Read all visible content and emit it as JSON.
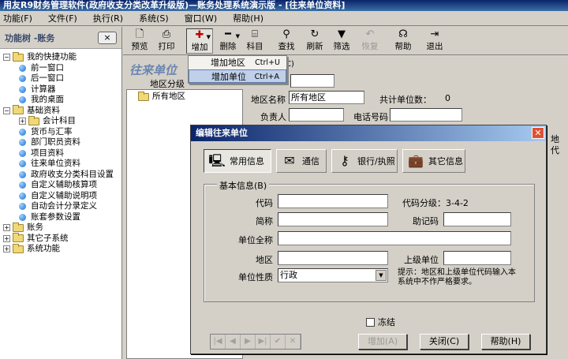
{
  "window": {
    "title": "用友R9财务管理软件(政府收支分类改革升级版)—账务处理系统演示版 - [往来单位资料]"
  },
  "menu": [
    "功能(F)",
    "文件(F)",
    "执行(R)",
    "系统(S)",
    "窗口(W)",
    "帮助(H)"
  ],
  "left_panel": {
    "title": "功能树 -账务",
    "close": "×",
    "tree": [
      {
        "label": "我的快捷功能",
        "kind": "folder",
        "expand": "−",
        "level": 0
      },
      {
        "label": "前一窗口",
        "kind": "item",
        "level": 1
      },
      {
        "label": "后一窗口",
        "kind": "item",
        "level": 1
      },
      {
        "label": "计算器",
        "kind": "item",
        "level": 1
      },
      {
        "label": "我的桌面",
        "kind": "item",
        "level": 1
      },
      {
        "label": "基础资料",
        "kind": "folder",
        "expand": "−",
        "level": 0
      },
      {
        "label": "会计科目",
        "kind": "folder",
        "expand": "+",
        "level": 1
      },
      {
        "label": "货币与汇率",
        "kind": "item",
        "level": 1
      },
      {
        "label": "部门职员资料",
        "kind": "item",
        "level": 1
      },
      {
        "label": "项目资料",
        "kind": "item",
        "level": 1
      },
      {
        "label": "往来单位资料",
        "kind": "item",
        "level": 1
      },
      {
        "label": "政府收支分类科目设置",
        "kind": "item",
        "level": 1
      },
      {
        "label": "自定义辅助核算项",
        "kind": "item",
        "level": 1
      },
      {
        "label": "自定义辅助说明项",
        "kind": "item",
        "level": 1
      },
      {
        "label": "自动会计分录定义",
        "kind": "item",
        "level": 1
      },
      {
        "label": "账套参数设置",
        "kind": "item",
        "level": 1
      },
      {
        "label": "账务",
        "kind": "folder",
        "expand": "+",
        "level": 0
      },
      {
        "label": "其它子系统",
        "kind": "folder",
        "expand": "+",
        "level": 0
      },
      {
        "label": "系统功能",
        "kind": "folder",
        "expand": "+",
        "level": 0
      }
    ]
  },
  "toolbar": [
    {
      "label": "预览",
      "icon": "preview-icon",
      "glyph": "🗋"
    },
    {
      "label": "打印",
      "icon": "printer-icon",
      "glyph": "⎙"
    },
    {
      "label": "增加",
      "icon": "plus-icon",
      "glyph": "✚",
      "dropdown": true
    },
    {
      "label": "删除",
      "icon": "minus-icon",
      "glyph": "━",
      "dropdown": true
    },
    {
      "label": "科目",
      "icon": "account-icon",
      "glyph": "⌸"
    },
    {
      "label": "查找",
      "icon": "binoculars-icon",
      "glyph": "⚲"
    },
    {
      "label": "刷新",
      "icon": "refresh-icon",
      "glyph": "↻"
    },
    {
      "label": "筛选",
      "icon": "filter-icon",
      "glyph": "▼"
    },
    {
      "label": "恢复",
      "icon": "undo-icon",
      "glyph": "↶",
      "disabled": true
    },
    {
      "label": "帮助",
      "icon": "help-icon",
      "glyph": "☊"
    },
    {
      "label": "退出",
      "icon": "exit-icon",
      "glyph": "⇥"
    }
  ],
  "add_menu": [
    {
      "label": "增加地区",
      "shortcut": "Ctrl+U"
    },
    {
      "label": "增加单位",
      "shortcut": "Ctrl+A"
    }
  ],
  "workbench": {
    "title": "往来单位",
    "hint": "C)",
    "region_grade_label": "地区分级",
    "tree_root": "所有地区",
    "region_name_label": "地区名称",
    "region_name_value": "所有地区",
    "unit_count_label": "共计单位数：",
    "unit_count_value": "0",
    "person_label": "负责人",
    "phone_label": "电话号码",
    "col_fragment_1": "地",
    "col_fragment_2": "代"
  },
  "dialog": {
    "title": "编辑往来单位",
    "close": "✕",
    "tabs": [
      {
        "label": "常用信息",
        "icon": "computer-icon",
        "glyph": "🖳"
      },
      {
        "label": "通信",
        "icon": "mail-icon",
        "glyph": "✉"
      },
      {
        "label": "银行/执照",
        "icon": "keys-icon",
        "glyph": "⚷"
      },
      {
        "label": "其它信息",
        "icon": "briefcase-icon",
        "glyph": "💼"
      }
    ],
    "group_title": "基本信息(B)",
    "labels": {
      "code": "代码",
      "code_grade": "代码分级：3-4-2",
      "short_name": "简称",
      "mnemonic": "助记码",
      "full_name": "单位全称",
      "region": "地区",
      "parent_unit": "上级单位",
      "unit_type": "单位性质"
    },
    "unit_type_value": "行政",
    "hint": "提示：地区和上级单位代码输入本系统中不作严格要求。",
    "freeze_label": "冻结",
    "nav_buttons": [
      "|◀",
      "◀",
      "▶",
      "▶|",
      "✔",
      "✕"
    ],
    "buttons": {
      "add": "增加(A)",
      "close": "关闭(C)",
      "help": "帮助(H)"
    }
  }
}
